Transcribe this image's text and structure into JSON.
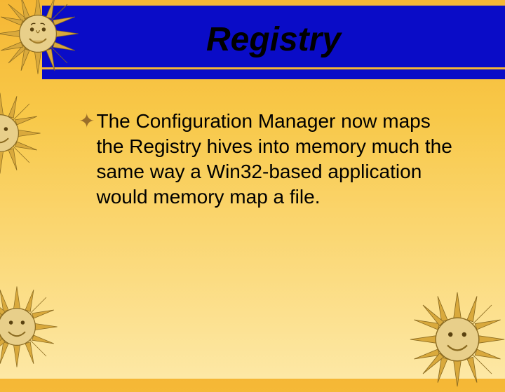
{
  "title": "Registry",
  "bullet_glyph": "✦",
  "body_text": "The Configuration Manager now maps the Registry hives into memory much the same way a Win32-based application would memory map a file.",
  "colors": {
    "title_bar": "#0a0cc7",
    "accent": "#f5b735",
    "bullet": "#9a6e2a"
  }
}
